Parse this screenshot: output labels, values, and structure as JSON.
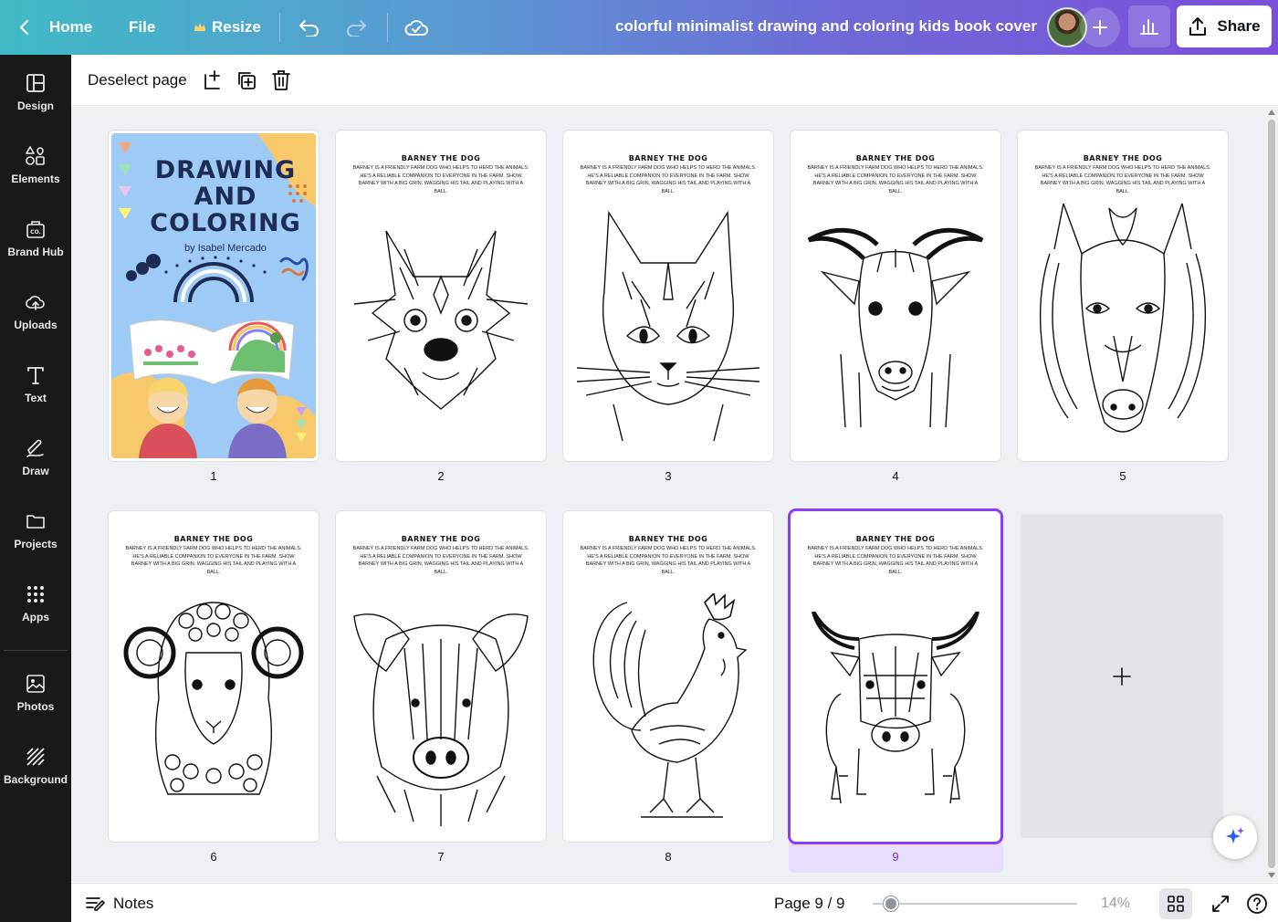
{
  "topbar": {
    "home_label": "Home",
    "file_label": "File",
    "resize_label": "Resize",
    "doc_title": "colorful minimalist drawing and coloring kids book cover",
    "share_label": "Share"
  },
  "rail": {
    "items": [
      {
        "label": "Design"
      },
      {
        "label": "Elements"
      },
      {
        "label": "Brand Hub"
      },
      {
        "label": "Uploads"
      },
      {
        "label": "Text"
      },
      {
        "label": "Draw"
      },
      {
        "label": "Projects"
      },
      {
        "label": "Apps"
      },
      {
        "label": "Photos"
      },
      {
        "label": "Background"
      }
    ]
  },
  "ctxbar": {
    "deselect_label": "Deselect page"
  },
  "cover": {
    "title": "DRAWING AND COLORING",
    "byline": "by Isabel Mercado",
    "colors": {
      "bg": "#9ecbf5",
      "title": "#1d2b55"
    }
  },
  "page_template": {
    "title": "BARNEY THE DOG",
    "body": "BARNEY IS A FRIENDLY FARM DOG WHO HELPS TO HERD THE ANIMALS. HE'S A RELIABLE COMPANION TO EVERYONE IN THE FARM. SHOW BARNEY WITH A BIG GRIN, WAGGING HIS TAIL AND PLAYING WITH A BALL."
  },
  "pages": [
    {
      "number": "1",
      "art": "cover"
    },
    {
      "number": "2",
      "art": "dog"
    },
    {
      "number": "3",
      "art": "cat"
    },
    {
      "number": "4",
      "art": "goat"
    },
    {
      "number": "5",
      "art": "horse"
    },
    {
      "number": "6",
      "art": "sheep"
    },
    {
      "number": "7",
      "art": "pig"
    },
    {
      "number": "8",
      "art": "rooster"
    },
    {
      "number": "9",
      "art": "cow"
    }
  ],
  "selected_page": "9",
  "bottombar": {
    "notes_label": "Notes",
    "page_indicator": "Page 9 / 9",
    "zoom_level": "14%"
  },
  "colors": {
    "accent": "#8b3dff",
    "rail_bg": "#18191b",
    "canvas_bg": "#eef0f3"
  }
}
